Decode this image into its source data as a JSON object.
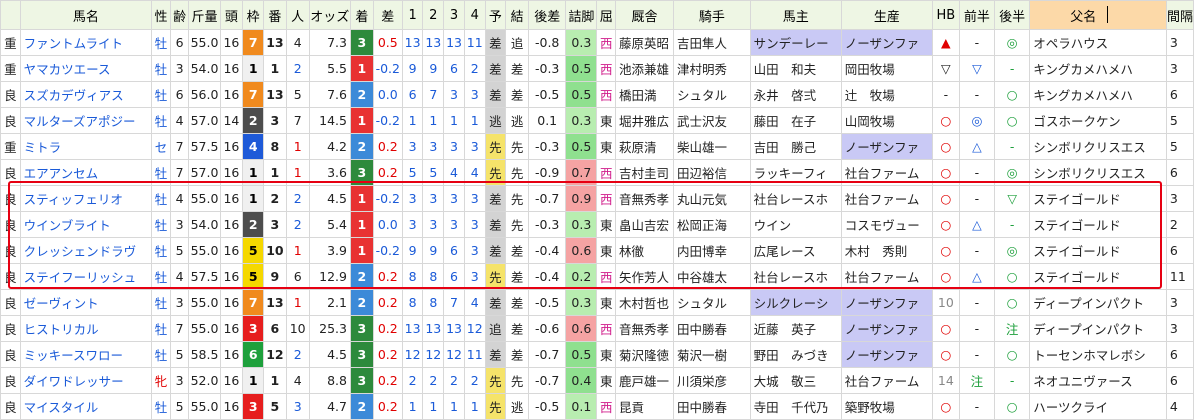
{
  "headers": [
    "",
    "馬名",
    "性",
    "齢",
    "斤量",
    "頭",
    "枠",
    "番",
    "人",
    "オッズ",
    "着",
    "差",
    "1",
    "2",
    "3",
    "4",
    "予",
    "結",
    "後差",
    "詰脚",
    "屈",
    "厩舎",
    "騎手",
    "馬主",
    "生産",
    "HB",
    "前半",
    "後半",
    "父名",
    "間隔"
  ],
  "rows": [
    {
      "baba": "重",
      "name": "ファントムライト",
      "sex": "牡",
      "age": "6",
      "kin": "55.0",
      "to": "16",
      "waku": "7",
      "ban": "13",
      "nin": "4",
      "odds": "7.3",
      "chaku": "3",
      "sa": "0.5",
      "c1": "13",
      "c2": "13",
      "c3": "13",
      "c4": "11",
      "yoso": "差",
      "ketsu": "追",
      "kosa": "-0.8",
      "tsume": "0.3",
      "kutsu": "西",
      "kyu": "藤原英昭",
      "kishu": "吉田隼人",
      "owner": "サンデーレー",
      "seisan": "ノーザンファ",
      "hb": "▲",
      "zen": "-",
      "kou": "◎",
      "chichi": "オペラハウス",
      "kan": "3"
    },
    {
      "baba": "重",
      "name": "ヤマカツエース",
      "sex": "牡",
      "age": "3",
      "kin": "54.0",
      "to": "16",
      "waku": "1",
      "ban": "1",
      "nin": "2",
      "odds": "5.5",
      "chaku": "1",
      "sa": "-0.2",
      "c1": "9",
      "c2": "9",
      "c3": "6",
      "c4": "2",
      "yoso": "差",
      "ketsu": "差",
      "kosa": "-0.3",
      "tsume": "0.5",
      "kutsu": "西",
      "kyu": "池添兼雄",
      "kishu": "津村明秀",
      "owner": "山田　和夫",
      "seisan": "岡田牧場",
      "hb": "▽",
      "zen": "▽",
      "kou": "-",
      "chichi": "キングカメハメハ",
      "kan": "3"
    },
    {
      "baba": "良",
      "name": "スズカデヴィアス",
      "sex": "牡",
      "age": "6",
      "kin": "56.0",
      "to": "16",
      "waku": "7",
      "ban": "13",
      "nin": "5",
      "odds": "7.6",
      "chaku": "2",
      "sa": "0.0",
      "c1": "6",
      "c2": "7",
      "c3": "3",
      "c4": "3",
      "yoso": "差",
      "ketsu": "差",
      "kosa": "-0.5",
      "tsume": "0.5",
      "kutsu": "西",
      "kyu": "橋田満",
      "kishu": "シュタル",
      "owner": "永井　啓弍",
      "seisan": "辻　牧場",
      "hb": "-",
      "zen": "-",
      "kou": "○",
      "chichi": "キングカメハメハ",
      "kan": "6"
    },
    {
      "baba": "良",
      "name": "マルターズアポジー",
      "sex": "牡",
      "age": "4",
      "kin": "57.0",
      "to": "14",
      "waku": "2",
      "ban": "3",
      "nin": "7",
      "odds": "14.5",
      "chaku": "1",
      "sa": "-0.2",
      "c1": "1",
      "c2": "1",
      "c3": "1",
      "c4": "1",
      "yoso": "逃",
      "ketsu": "逃",
      "kosa": "0.1",
      "tsume": "0.3",
      "kutsu": "東",
      "kyu": "堀井雅広",
      "kishu": "武士沢友",
      "owner": "藤田　在子",
      "seisan": "山岡牧場",
      "hb": "○",
      "zen": "◎",
      "kou": "○",
      "chichi": "ゴスホークケン",
      "kan": "5"
    },
    {
      "baba": "重",
      "name": "ミトラ",
      "sex": "セ",
      "age": "7",
      "kin": "57.5",
      "to": "16",
      "waku": "4",
      "ban": "8",
      "nin": "1",
      "odds": "4.2",
      "chaku": "2",
      "sa": "0.2",
      "c1": "3",
      "c2": "3",
      "c3": "3",
      "c4": "3",
      "yoso": "先",
      "ketsu": "先",
      "kosa": "-0.3",
      "tsume": "0.5",
      "kutsu": "東",
      "kyu": "萩原清",
      "kishu": "柴山雄一",
      "owner": "吉田　勝己",
      "seisan": "ノーザンファ",
      "hb": "○",
      "zen": "△",
      "kou": "-",
      "chichi": "シンボリクリスエス",
      "kan": "5"
    },
    {
      "baba": "良",
      "name": "エアアンセム",
      "sex": "牡",
      "age": "7",
      "kin": "57.0",
      "to": "16",
      "waku": "1",
      "ban": "1",
      "nin": "1",
      "odds": "3.6",
      "chaku": "3",
      "sa": "0.2",
      "c1": "5",
      "c2": "5",
      "c3": "4",
      "c4": "4",
      "yoso": "先",
      "ketsu": "先",
      "kosa": "-0.9",
      "tsume": "0.7",
      "kutsu": "西",
      "kyu": "吉村圭司",
      "kishu": "田辺裕信",
      "owner": "ラッキーフィ",
      "seisan": "社台ファーム",
      "hb": "○",
      "zen": "-",
      "kou": "◎",
      "chichi": "シンボリクリスエス",
      "kan": "6"
    },
    {
      "baba": "良",
      "name": "スティッフェリオ",
      "sex": "牡",
      "age": "4",
      "kin": "55.0",
      "to": "16",
      "waku": "1",
      "ban": "2",
      "nin": "2",
      "odds": "4.5",
      "chaku": "1",
      "sa": "-0.2",
      "c1": "3",
      "c2": "3",
      "c3": "3",
      "c4": "3",
      "yoso": "差",
      "ketsu": "先",
      "kosa": "-0.7",
      "tsume": "0.9",
      "kutsu": "西",
      "kyu": "音無秀孝",
      "kishu": "丸山元気",
      "owner": "社台レースホ",
      "seisan": "社台ファーム",
      "hb": "○",
      "zen": "-",
      "kou": "▽",
      "chichi": "ステイゴールド",
      "kan": "3"
    },
    {
      "baba": "良",
      "name": "ウインブライト",
      "sex": "牡",
      "age": "3",
      "kin": "54.0",
      "to": "16",
      "waku": "2",
      "ban": "3",
      "nin": "2",
      "odds": "5.4",
      "chaku": "1",
      "sa": "0.0",
      "c1": "3",
      "c2": "3",
      "c3": "3",
      "c4": "3",
      "yoso": "差",
      "ketsu": "先",
      "kosa": "-0.3",
      "tsume": "0.3",
      "kutsu": "東",
      "kyu": "畠山吉宏",
      "kishu": "松岡正海",
      "owner": "ウイン",
      "seisan": "コスモヴュー",
      "hb": "○",
      "zen": "△",
      "kou": "-",
      "chichi": "ステイゴールド",
      "kan": "2"
    },
    {
      "baba": "良",
      "name": "クレッシェンドラヴ",
      "sex": "牡",
      "age": "5",
      "kin": "55.0",
      "to": "16",
      "waku": "5",
      "ban": "10",
      "nin": "1",
      "odds": "3.9",
      "chaku": "1",
      "sa": "-0.2",
      "c1": "9",
      "c2": "9",
      "c3": "6",
      "c4": "3",
      "yoso": "差",
      "ketsu": "差",
      "kosa": "-0.4",
      "tsume": "0.6",
      "kutsu": "東",
      "kyu": "林徹",
      "kishu": "内田博幸",
      "owner": "広尾レース",
      "seisan": "木村　秀則",
      "hb": "○",
      "zen": "-",
      "kou": "◎",
      "chichi": "ステイゴールド",
      "kan": "6"
    },
    {
      "baba": "良",
      "name": "ステイフーリッシュ",
      "sex": "牡",
      "age": "4",
      "kin": "57.5",
      "to": "16",
      "waku": "5",
      "ban": "9",
      "nin": "6",
      "odds": "12.9",
      "chaku": "2",
      "sa": "0.2",
      "c1": "8",
      "c2": "8",
      "c3": "6",
      "c4": "3",
      "yoso": "先",
      "ketsu": "差",
      "kosa": "-0.4",
      "tsume": "0.2",
      "kutsu": "西",
      "kyu": "矢作芳人",
      "kishu": "中谷雄太",
      "owner": "社台レースホ",
      "seisan": "社台ファーム",
      "hb": "○",
      "zen": "△",
      "kou": "○",
      "chichi": "ステイゴールド",
      "kan": "11"
    },
    {
      "baba": "良",
      "name": "ゼーヴィント",
      "sex": "牡",
      "age": "3",
      "kin": "55.0",
      "to": "16",
      "waku": "7",
      "ban": "13",
      "nin": "1",
      "odds": "2.1",
      "chaku": "2",
      "sa": "0.2",
      "c1": "8",
      "c2": "8",
      "c3": "7",
      "c4": "4",
      "yoso": "差",
      "ketsu": "差",
      "kosa": "-0.5",
      "tsume": "0.3",
      "kutsu": "東",
      "kyu": "木村哲也",
      "kishu": "シュタル",
      "owner": "シルクレーシ",
      "seisan": "ノーザンファ",
      "hb": "10",
      "zen": "-",
      "kou": "○",
      "chichi": "ディープインパクト",
      "kan": "3"
    },
    {
      "baba": "良",
      "name": "ヒストリカル",
      "sex": "牡",
      "age": "7",
      "kin": "55.0",
      "to": "16",
      "waku": "3",
      "ban": "6",
      "nin": "10",
      "odds": "25.3",
      "chaku": "3",
      "sa": "0.2",
      "c1": "13",
      "c2": "13",
      "c3": "13",
      "c4": "12",
      "yoso": "追",
      "ketsu": "差",
      "kosa": "-0.6",
      "tsume": "0.6",
      "kutsu": "西",
      "kyu": "音無秀孝",
      "kishu": "田中勝春",
      "owner": "近藤　英子",
      "seisan": "ノーザンファ",
      "hb": "○",
      "zen": "-",
      "kou": "注",
      "chichi": "ディープインパクト",
      "kan": "3"
    },
    {
      "baba": "良",
      "name": "ミッキースワロー",
      "sex": "牡",
      "age": "5",
      "kin": "58.5",
      "to": "16",
      "waku": "6",
      "ban": "12",
      "nin": "2",
      "odds": "4.5",
      "chaku": "3",
      "sa": "0.2",
      "c1": "12",
      "c2": "12",
      "c3": "12",
      "c4": "11",
      "yoso": "差",
      "ketsu": "差",
      "kosa": "-0.7",
      "tsume": "0.5",
      "kutsu": "東",
      "kyu": "菊沢隆徳",
      "kishu": "菊沢一樹",
      "owner": "野田　みづき",
      "seisan": "ノーザンファ",
      "hb": "○",
      "zen": "-",
      "kou": "○",
      "chichi": "トーセンホマレボシ",
      "kan": "6"
    },
    {
      "baba": "良",
      "name": "ダイワドレッサー",
      "sex": "牝",
      "age": "3",
      "kin": "52.0",
      "to": "16",
      "waku": "1",
      "ban": "1",
      "nin": "4",
      "odds": "8.8",
      "chaku": "3",
      "sa": "0.2",
      "c1": "2",
      "c2": "2",
      "c3": "2",
      "c4": "2",
      "yoso": "先",
      "ketsu": "先",
      "kosa": "-0.7",
      "tsume": "0.4",
      "kutsu": "東",
      "kyu": "鹿戸雄一",
      "kishu": "川須栄彦",
      "owner": "大城　敬三",
      "seisan": "社台ファーム",
      "hb": "14",
      "zen": "注",
      "kou": "-",
      "chichi": "ネオユニヴァース",
      "kan": "6"
    },
    {
      "baba": "良",
      "name": "マイスタイル",
      "sex": "牡",
      "age": "5",
      "kin": "55.0",
      "to": "16",
      "waku": "3",
      "ban": "5",
      "nin": "3",
      "odds": "4.7",
      "chaku": "2",
      "sa": "0.2",
      "c1": "1",
      "c2": "1",
      "c3": "1",
      "c4": "1",
      "yoso": "先",
      "ketsu": "逃",
      "kosa": "-0.5",
      "tsume": "0.1",
      "kutsu": "西",
      "kyu": "昆貢",
      "kishu": "田中勝春",
      "owner": "寺田　千代乃",
      "seisan": "築野牧場",
      "hb": "○",
      "zen": "-",
      "kou": "○",
      "chichi": "ハーツクライ",
      "kan": "4"
    }
  ]
}
